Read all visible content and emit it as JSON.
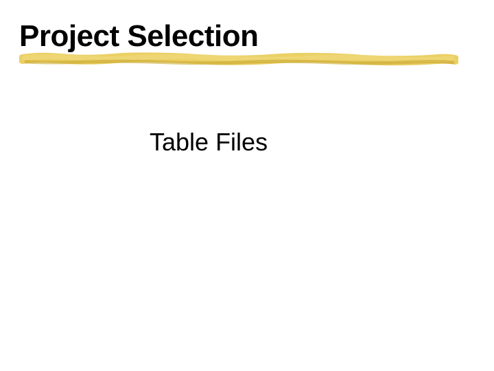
{
  "slide": {
    "title": "Project Selection",
    "subtitle": "Table Files"
  },
  "colors": {
    "stroke_yellow": "#e8c84a",
    "stroke_highlight": "#f0d87a",
    "stroke_shadow": "#c9a830"
  }
}
